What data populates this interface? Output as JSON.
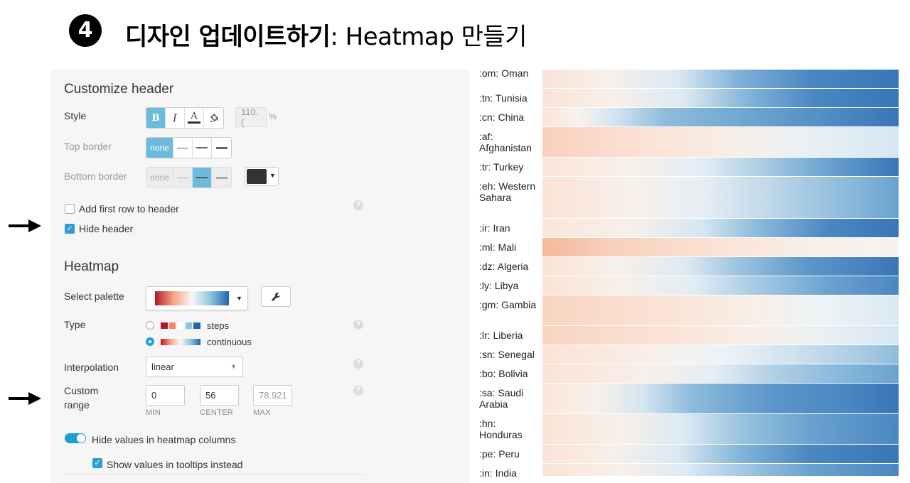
{
  "title": {
    "step_badge": "4",
    "bold_part": "디자인 업데이트하기",
    "rest_part": ": Heatmap 만들기"
  },
  "arrows": [
    "arrow-right-icon",
    "arrow-right-icon"
  ],
  "header_section": {
    "heading": "Customize header",
    "style_label": "Style",
    "style_buttons": [
      "B",
      "I",
      "A",
      "paint-bucket-icon"
    ],
    "style_size_value": "110.(",
    "style_size_unit": "%",
    "top_border_label": "Top border",
    "bottom_border_label": "Bottom border",
    "border_none": "none",
    "add_first_row_label": "Add first row to header",
    "hide_header_label": "Hide header",
    "help": "?"
  },
  "heatmap_section": {
    "heading": "Heatmap",
    "select_palette_label": "Select palette",
    "type_label": "Type",
    "type_steps": "steps",
    "type_continuous": "continuous",
    "interpolation_label": "Interpolation",
    "interpolation_value": "linear",
    "custom_range_label_1": "Custom",
    "custom_range_label_2": "range",
    "min_value": "0",
    "center_value": "56",
    "max_value": "78.921",
    "min_label": "MIN",
    "center_label": "CENTER",
    "max_label": "MAX",
    "hide_values_label": "Hide values in heatmap columns",
    "show_tooltips_label": "Show values in tooltips instead"
  },
  "colors": {
    "accent": "#6dbbdc",
    "checkbox": "#2e9ed5",
    "heat_low": "#f4a582",
    "heat_mid": "#f7f7f7",
    "heat_high": "#2166ac"
  },
  "heatmap_rows": [
    {
      "label": ":om: Oman"
    },
    {
      "label": ":tn: Tunisia"
    },
    {
      "label": ":cn: China"
    },
    {
      "label": ":af: Afghanistan"
    },
    {
      "label": ":tr: Turkey"
    },
    {
      "label": ":eh: Western Sahara"
    },
    {
      "label": ":ir: Iran"
    },
    {
      "label": ":ml: Mali"
    },
    {
      "label": ":dz: Algeria"
    },
    {
      "label": ":ly: Libya"
    },
    {
      "label": ":gm: Gambia"
    },
    {
      "label": ":lr: Liberia"
    },
    {
      "label": ":sn: Senegal"
    },
    {
      "label": ":bo: Bolivia"
    },
    {
      "label": ":sa: Saudi Arabia"
    },
    {
      "label": ":hn: Honduras"
    },
    {
      "label": ":pe: Peru"
    },
    {
      "label": ":in: India"
    }
  ]
}
